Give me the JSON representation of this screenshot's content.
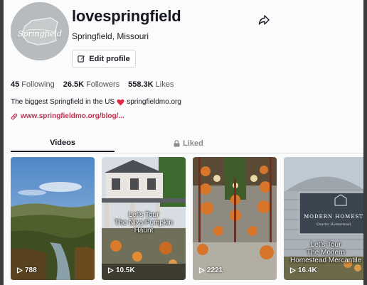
{
  "profile": {
    "username": "lovespringfield",
    "display_name": "Springfield, Missouri",
    "avatar_text": "Springfield",
    "edit_label": "Edit profile",
    "stats": [
      {
        "value": "45",
        "label": "Following"
      },
      {
        "value": "26.5K",
        "label": "Followers"
      },
      {
        "value": "558.3K",
        "label": "Likes"
      }
    ],
    "bio_before": "The biggest Springfield in the US",
    "bio_after": "springfieldmo.org",
    "link": "www.springfieldmo.org/blog/..."
  },
  "tabs": {
    "videos": "Videos",
    "liked": "Liked"
  },
  "videos": [
    {
      "views": "788",
      "overlay": []
    },
    {
      "views": "10.5K",
      "overlay": [
        "Let's Tour",
        "The Nixa Pumpkin",
        "Haunt"
      ]
    },
    {
      "views": "2221",
      "overlay": []
    },
    {
      "views": "16.4K",
      "overlay": [
        "Let's Tour",
        "The Modern",
        "Homestead Mercantile"
      ],
      "sign": [
        "MODERN HOMEST",
        "Ozarks Homestead"
      ]
    }
  ],
  "colors": {
    "text": "#161823",
    "link": "#c0304f",
    "heart": "#e0294a"
  }
}
